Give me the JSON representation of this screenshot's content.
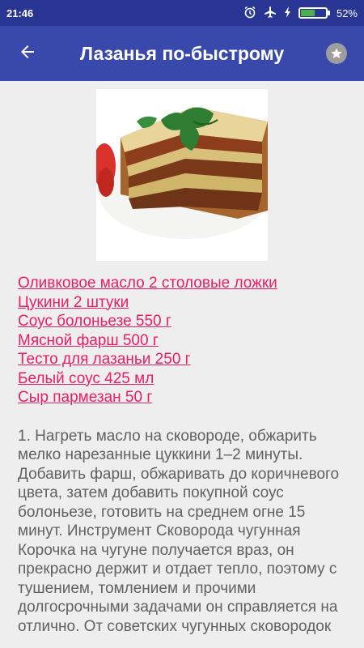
{
  "status_bar": {
    "time": "21:46",
    "battery_percent": "52%",
    "battery_level": 0.52
  },
  "app_bar": {
    "title": "Лазанья по-быстрому",
    "back_icon": "arrow-back-icon",
    "favorite_icon": "star-icon"
  },
  "recipe": {
    "ingredients": [
      "Оливковое масло 2 столовые ложки",
      "Цукини 2 штуки",
      "Соус болоньезе 550 г",
      "Мясной фарш 500 г",
      "Тесто для лазаньи 250 г",
      "Белый соус 425 мл",
      "Сыр пармезан 50 г"
    ],
    "instructions": "1. Нагреть масло на сковороде, обжарить мелко нарезанные цуккини 1–2 минуты. Добавить фарш, обжаривать до коричневого цвета, затем добавить покупной соус болоньезе, готовить на среднем огне 15 минут. Инструмент Сковорода чугунная Корочка на чугуне получается враз, он прекрасно держит и отдает тепло, поэтому с тушением, томлением и прочими долгосрочными задачами он справляется на отлично. От советских чугунных сковородок"
  },
  "colors": {
    "status_bar": "#283593",
    "app_bar": "#3949ab",
    "link": "#e91e63",
    "text": "#616161",
    "background": "#eeeeee"
  }
}
